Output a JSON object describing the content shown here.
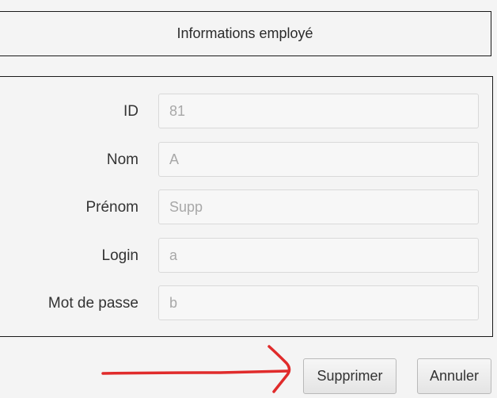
{
  "header": {
    "title": "Informations employé"
  },
  "form": {
    "fields": [
      {
        "label": "ID",
        "value": "81"
      },
      {
        "label": "Nom",
        "value": "A"
      },
      {
        "label": "Prénom",
        "value": "Supp"
      },
      {
        "label": "Login",
        "value": "a"
      },
      {
        "label": "Mot de passe",
        "value": "b"
      }
    ]
  },
  "actions": {
    "delete_label": "Supprimer",
    "cancel_label": "Annuler"
  },
  "annotation": {
    "icon": "red-arrow-icon",
    "color": "#e02b2b"
  },
  "colors": {
    "background": "#f4f4f4",
    "border": "#1a1a1a",
    "field_text": "#a8a8a8"
  }
}
